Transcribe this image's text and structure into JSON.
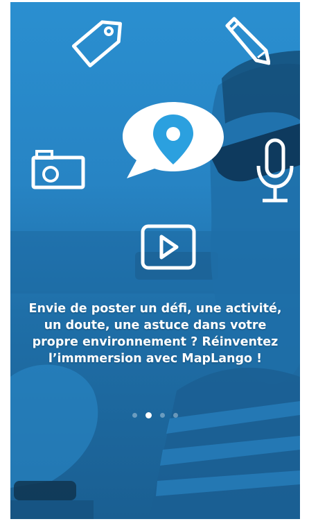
{
  "onboarding": {
    "message_lines": [
      "Envie de poster un défi, une activité,",
      "un doute, une astuce dans votre",
      "propre environnement ? Réinventez",
      "l’immmersion avec MapLango !"
    ]
  },
  "pager": {
    "total": 4,
    "active_index": 1
  },
  "icons": [
    "tag-icon",
    "pencil-icon",
    "map-pin-chat-icon",
    "camera-icon",
    "microphone-icon",
    "video-play-icon"
  ],
  "colors": {
    "overlay_blue": "#2784c4",
    "text": "#ffffff",
    "pin_blue": "#2ba0df"
  }
}
